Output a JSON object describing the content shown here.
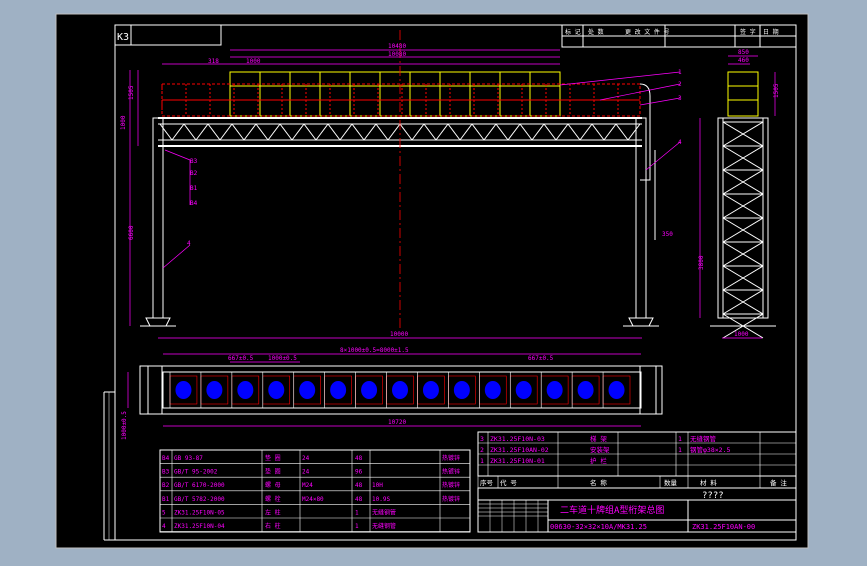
{
  "sheet": {
    "code": "K3",
    "revision_headers": [
      "标 记",
      "处 数",
      "更 改 文 件 号",
      "签 字",
      "日 期"
    ]
  },
  "dimensions": {
    "top_overall": "10480",
    "top_inner": "10080",
    "top_left": "318",
    "top_segment": "1000",
    "left_vertical": [
      "1505",
      "1000",
      "1000"
    ],
    "column_height": "6600",
    "span": "10000",
    "plan_spacing": "8×1000±0.5=8000±1.5",
    "plan_left": "667±0.5",
    "plan_seg": "1000±0.5",
    "plan_right": "667±0.5",
    "plan_overall": "10720",
    "plan_depth": "1000±0.5",
    "side_top_a": "850",
    "side_top_b": "460",
    "side_top_c": "1505",
    "side_column": "3800",
    "side_bottom": "1000",
    "right_note": "350"
  },
  "leader_labels": [
    "B3",
    "B2",
    "B1",
    "B4",
    "4",
    "1",
    "2",
    "3",
    "4"
  ],
  "bom_lower": [
    [
      "B4",
      "GB 93-87",
      "垫 圈",
      "24",
      "48",
      "",
      "热镀锌"
    ],
    [
      "B3",
      "GB/T 95-2002",
      "垫 圈",
      "24",
      "96",
      "",
      "热镀锌"
    ],
    [
      "B2",
      "GB/T 6170-2000",
      "螺 母",
      "M24",
      "48",
      "10H",
      "热镀锌"
    ],
    [
      "B1",
      "GB/T 5782-2000",
      "螺 栓",
      "M24×80",
      "48",
      "10.9S",
      "热镀锌"
    ],
    [
      "5",
      "ZK31.25F10N-05",
      "左 柱",
      "",
      "1",
      "无缝钢管",
      ""
    ],
    [
      "4",
      "ZK31.25F10N-04",
      "右 柱",
      "",
      "1",
      "无缝钢管",
      ""
    ]
  ],
  "bom_upper": [
    [
      "3",
      "ZK31.25F10N-03",
      "梯 架",
      "",
      "1",
      "无缝钢管"
    ],
    [
      "2",
      "ZK31.25F10AN-02",
      "安装架",
      "",
      "1",
      "钢管φ38×2.5"
    ],
    [
      "1",
      "ZK31.25F10N-01",
      "护 栏",
      "",
      "",
      ""
    ]
  ],
  "bom_header": [
    "序号",
    "代 号",
    "名 称",
    "数量",
    "材 料",
    "备 注"
  ],
  "title_block": {
    "question": "????",
    "title": "二车道十牌组A型桁架总图",
    "spec": "00630-32×32×10A/MK31.25",
    "drawing_no": "ZK31.25F10AN-00"
  },
  "colors": {
    "background": "#000000",
    "border": "#ffffff",
    "dimension": "#ff00ff",
    "structure": "#ffffff",
    "rail": "#ffff00",
    "hidden": "#ff0000",
    "blue": "#0000ff"
  }
}
